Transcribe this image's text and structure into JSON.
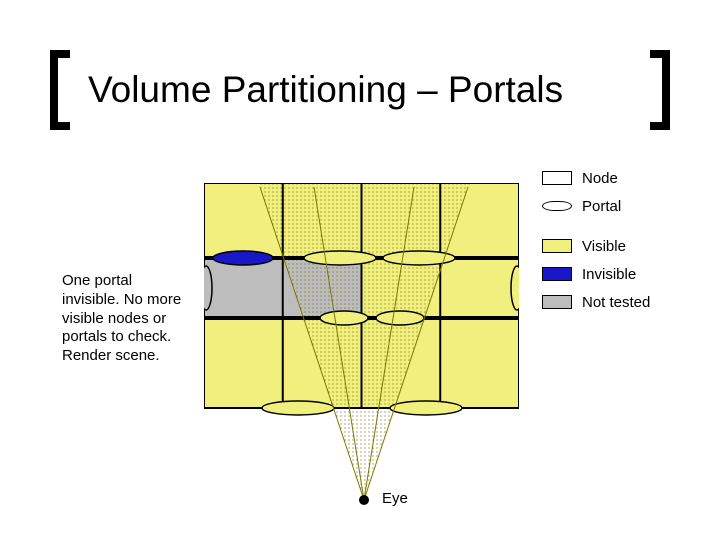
{
  "title": "Volume Partitioning – Portals",
  "left_note": "One portal invisible. No more visible nodes or portals to check. Render scene.",
  "eye_label": "Eye",
  "legend": {
    "node": "Node",
    "portal": "Portal",
    "visible": "Visible",
    "invisible": "Invisible",
    "not_tested": "Not tested"
  },
  "colors": {
    "visible": "#f1f07e",
    "invisible": "#1818c9",
    "not_tested": "#bdbdbd",
    "wall": "#000000"
  },
  "chart_data": {
    "type": "diagram",
    "description": "Portal visibility culling: 4×3 grid of cell nodes separated by walls; portals (openings) between cells; eye at bottom center casting frustum upward.",
    "grid": {
      "cols": 4,
      "rows": 3
    },
    "cells": [
      {
        "r": 0,
        "c": 0,
        "state": "visible"
      },
      {
        "r": 0,
        "c": 1,
        "state": "visible"
      },
      {
        "r": 0,
        "c": 2,
        "state": "visible"
      },
      {
        "r": 0,
        "c": 3,
        "state": "visible"
      },
      {
        "r": 1,
        "c": 0,
        "state": "not_tested"
      },
      {
        "r": 1,
        "c": 1,
        "state": "not_tested"
      },
      {
        "r": 1,
        "c": 2,
        "state": "visible"
      },
      {
        "r": 1,
        "c": 3,
        "state": "visible"
      },
      {
        "r": 2,
        "c": 0,
        "state": "visible"
      },
      {
        "r": 2,
        "c": 1,
        "state": "visible"
      },
      {
        "r": 2,
        "c": 2,
        "state": "visible"
      },
      {
        "r": 2,
        "c": 3,
        "state": "visible"
      }
    ],
    "portals": [
      {
        "between": [
          [
            0,
            0
          ],
          [
            1,
            0
          ]
        ],
        "state": "invisible"
      },
      {
        "between": [
          [
            0,
            1
          ],
          [
            1,
            1
          ]
        ],
        "state": "visible"
      },
      {
        "between": [
          [
            0,
            2
          ],
          [
            1,
            2
          ]
        ],
        "state": "visible"
      },
      {
        "between": [
          [
            1,
            1
          ],
          [
            2,
            1
          ]
        ],
        "state": "visible"
      },
      {
        "between": [
          [
            1,
            2
          ],
          [
            2,
            2
          ]
        ],
        "state": "visible"
      },
      {
        "between": [
          [
            2,
            0
          ],
          [
            2,
            1
          ]
        ],
        "state": "visible",
        "orientation": "vertical"
      },
      {
        "between": [
          [
            2,
            2
          ],
          [
            2,
            3
          ]
        ],
        "state": "visible",
        "orientation": "vertical"
      },
      {
        "between": [
          [
            1,
            0
          ],
          [
            1,
            1
          ]
        ],
        "state": "not_tested",
        "orientation": "vertical"
      },
      {
        "between": [
          [
            1,
            2
          ],
          [
            1,
            3
          ]
        ],
        "state": "visible",
        "orientation": "vertical"
      }
    ],
    "eye": {
      "x_fraction": 0.51,
      "y_below": true
    },
    "frustum": {
      "apex_x_fraction": 0.51,
      "spread_top_fraction": 0.9
    }
  }
}
